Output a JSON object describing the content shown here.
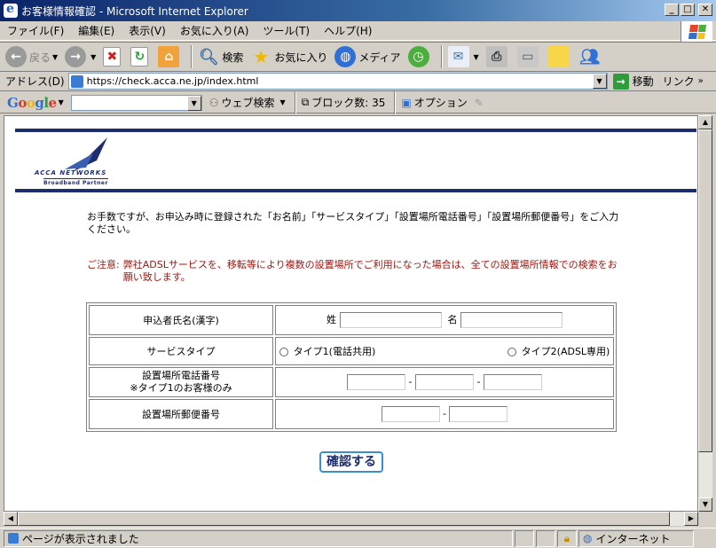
{
  "window": {
    "title": "お客様情報確認 - Microsoft Internet Explorer"
  },
  "menu": [
    "ファイル(F)",
    "編集(E)",
    "表示(V)",
    "お気に入り(A)",
    "ツール(T)",
    "ヘルプ(H)"
  ],
  "toolbar": {
    "back": "戻る",
    "search": "検索",
    "favorites": "お気に入り",
    "media": "メディア"
  },
  "address": {
    "label": "アドレス(D)",
    "url": "https://check.acca.ne.jp/index.html",
    "go": "移動",
    "links": "リンク"
  },
  "googlebar": {
    "logo": "Google",
    "search": "ウェブ検索",
    "blocked": "ブロック数: 35",
    "options": "オプション"
  },
  "page": {
    "logo_text": "ACCA NETWORKS",
    "logo_sub": "Broadband Partner",
    "intro": "お手数ですが、お申込み時に登録された「お名前」「サービスタイプ」「設置場所電話番号」「設置場所郵便番号」をご入力ください。",
    "caution_label": "ご注意:",
    "caution_text": "弊社ADSLサービスを、移転等により複数の設置場所でご利用になった場合は、全ての設置場所情報での検索をお願い致します。",
    "rows": {
      "name_label": "申込者氏名(漢字)",
      "sei": "姓",
      "mei": "名",
      "service_label": "サービスタイプ",
      "type1": "タイプ1(電話共用)",
      "type2": "タイプ2(ADSL専用)",
      "phone_label_1": "設置場所電話番号",
      "phone_label_2": "※タイプ1のお客様のみ",
      "zip_label": "設置場所郵便番号",
      "dash": "-"
    },
    "submit": "確認する"
  },
  "status": {
    "text": "ページが表示されました",
    "zone": "インターネット"
  },
  "colors": {
    "title_bar": "#0a246a",
    "brand_navy": "#1e2d6e",
    "caution_red": "#a0150f",
    "button_border": "#3a8fd0"
  }
}
